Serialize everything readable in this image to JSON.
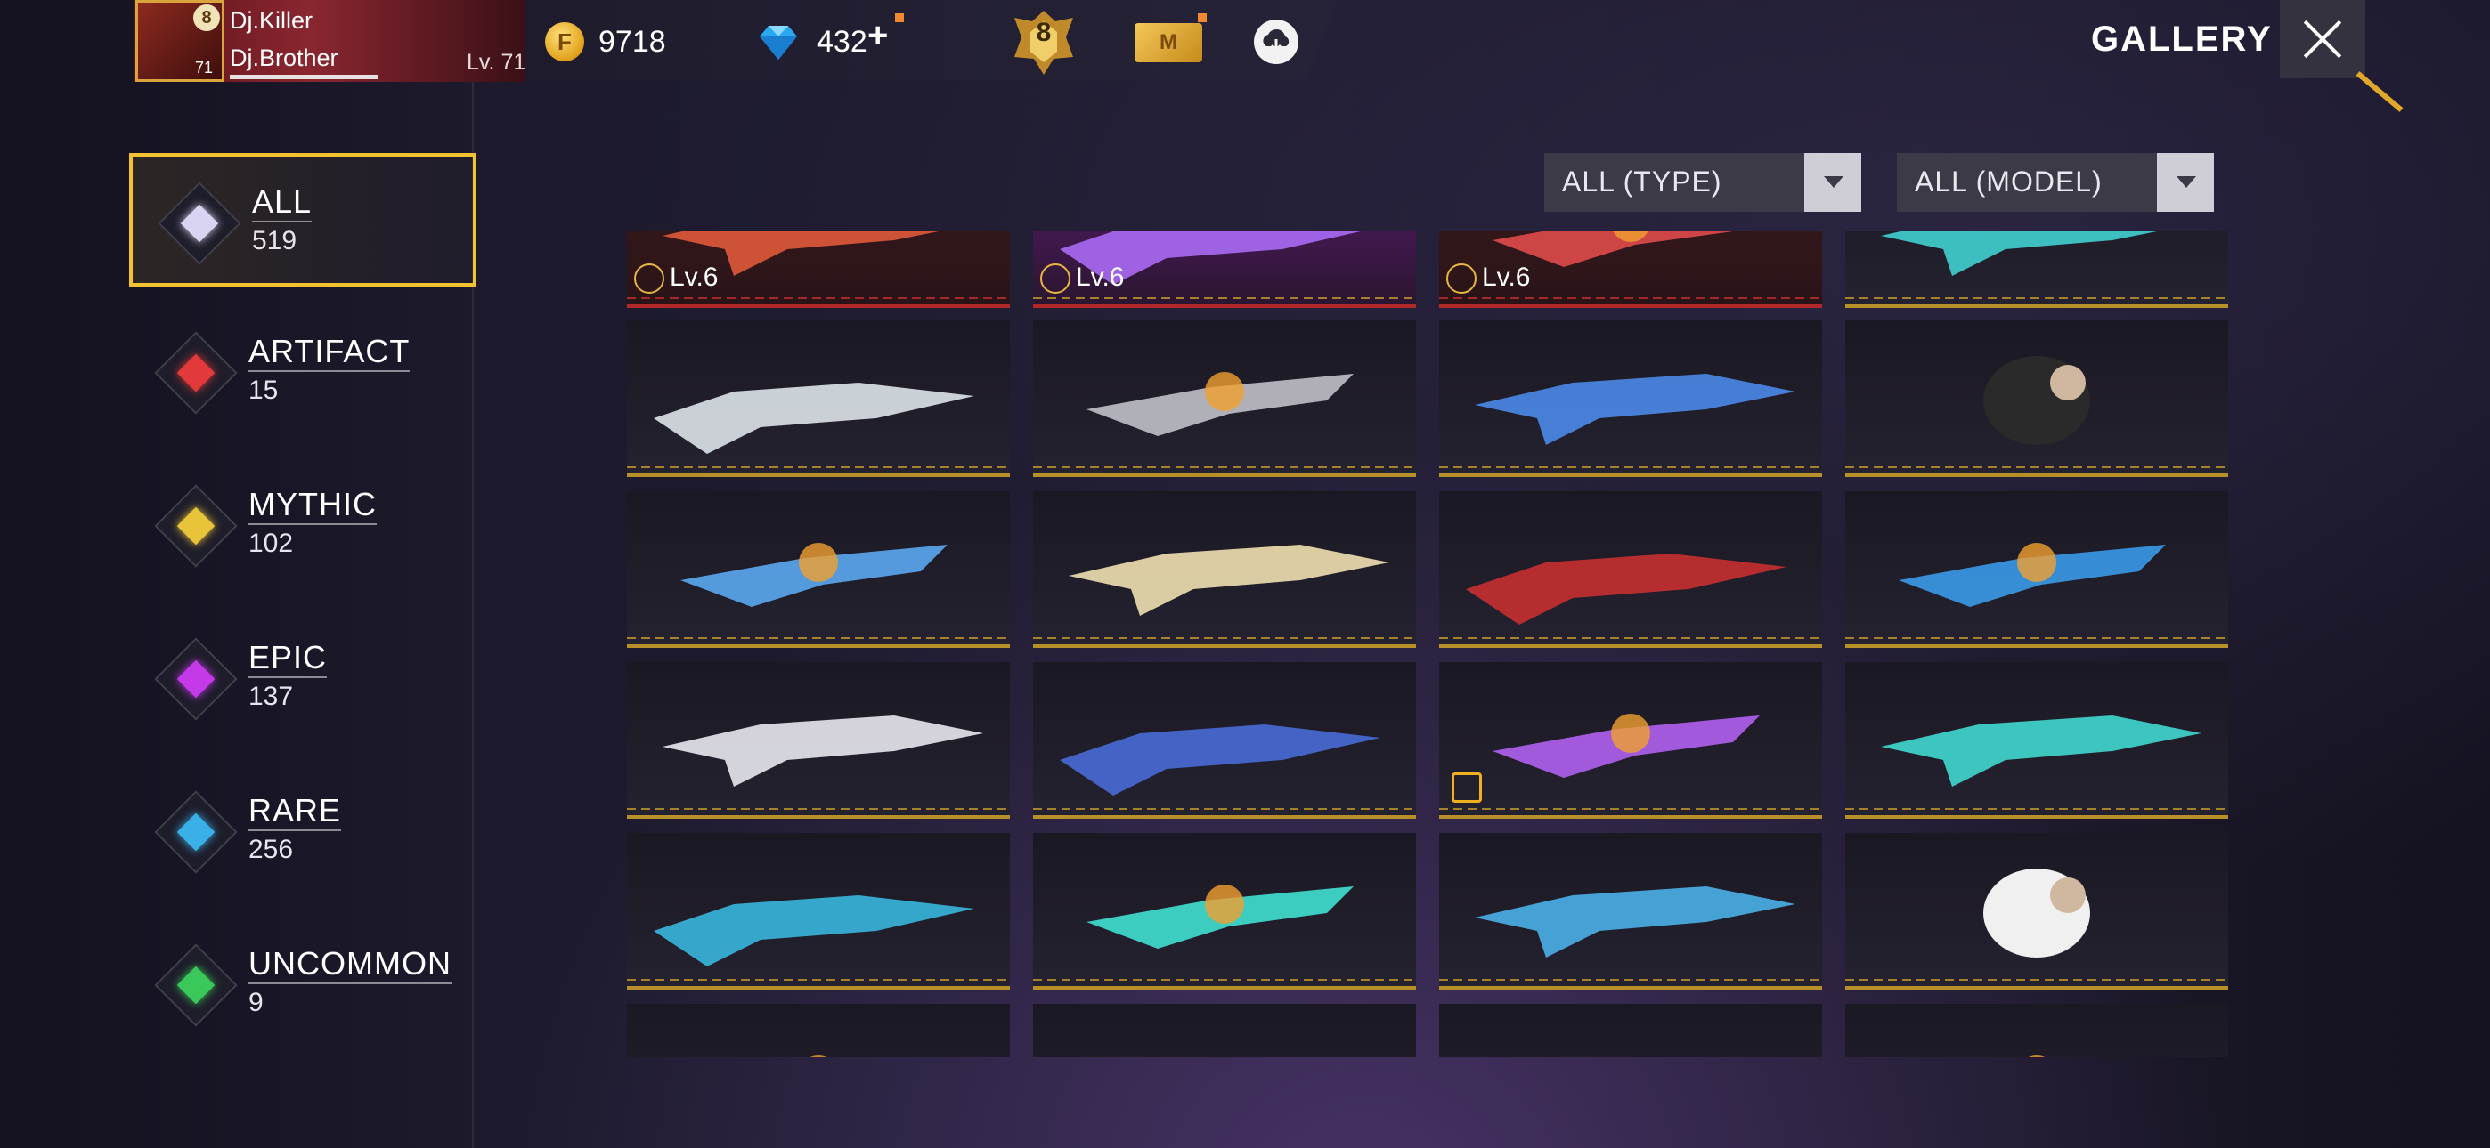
{
  "player": {
    "avatar_level": "71",
    "rank_badge": "8",
    "name1": "Dj.Killer",
    "name2": "Dj.Brother",
    "level": "Lv. 71"
  },
  "currency": {
    "coin_icon": "F",
    "coins": "9718",
    "diamonds": "432",
    "diamonds_add": "+",
    "rank": "8",
    "membership_icon": "M"
  },
  "header": {
    "title": "GALLERY"
  },
  "categories": [
    {
      "label": "ALL",
      "count": "519",
      "color": "#d8d4f2"
    },
    {
      "label": "ARTIFACT",
      "count": "15",
      "color": "#e23a3a"
    },
    {
      "label": "MYTHIC",
      "count": "102",
      "color": "#e8c43a"
    },
    {
      "label": "EPIC",
      "count": "137",
      "color": "#c43ae8"
    },
    {
      "label": "RARE",
      "count": "256",
      "color": "#3ab0e8"
    },
    {
      "label": "UNCOMMON",
      "count": "9",
      "color": "#3ac85a"
    }
  ],
  "filters": {
    "type": "ALL (TYPE)",
    "model": "ALL (MODEL)"
  },
  "items": {
    "row0": [
      {
        "level": "Lv.6",
        "color": "#e05a3a"
      },
      {
        "level": "Lv.6",
        "color": "#b070ff"
      },
      {
        "level": "Lv.6",
        "color": "#e04a4a"
      },
      {
        "level": "",
        "color": "#40d0d0"
      }
    ],
    "row1": [
      "#e8f0f4",
      "#c0c0c8",
      "#4a8ae8",
      "#2a2a2a"
    ],
    "row2": [
      "#5aa8f0",
      "#f0e0b0",
      "#d03030",
      "#3a9ae8"
    ],
    "row3": [
      "#e8e8f0",
      "#4a70e0",
      "#b060f0",
      "#40d8d0"
    ],
    "row4": [
      "#3ac0e8",
      "#40e0d0",
      "#4ab0e8",
      "#f0f0f0"
    ],
    "row5": [
      "#e8e8e8",
      "#40d0d0",
      "#3a8ae8",
      "#4a7ae8"
    ]
  }
}
